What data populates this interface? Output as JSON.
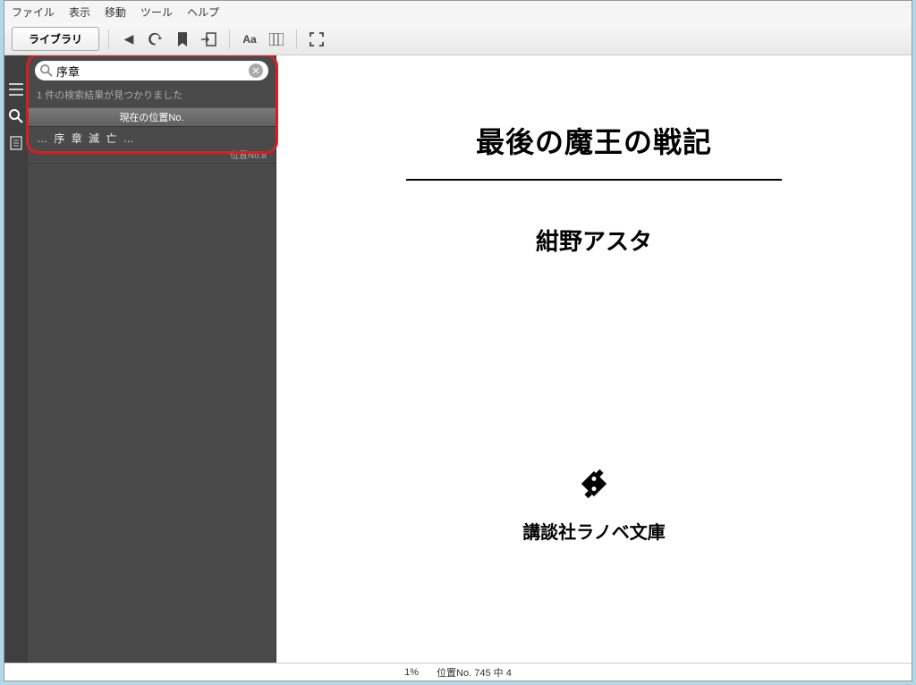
{
  "menubar": {
    "file": "ファイル",
    "view": "表示",
    "go": "移動",
    "tools": "ツール",
    "help": "ヘルプ"
  },
  "toolbar": {
    "library_label": "ライブラリ"
  },
  "sidebar": {
    "search_value": "序章",
    "result_count_text": "1 件の検索結果が見つかりました",
    "loc_header": "現在の位置No.",
    "result": {
      "label": "… 序 章 滅 亡 …",
      "loc": "位置No.8"
    }
  },
  "page": {
    "title": "最後の魔王の戦記",
    "author": "紺野アスタ",
    "publisher": "講談社ラノベ文庫"
  },
  "statusbar": {
    "percent": "1%",
    "location": "位置No. 745 中 4"
  }
}
